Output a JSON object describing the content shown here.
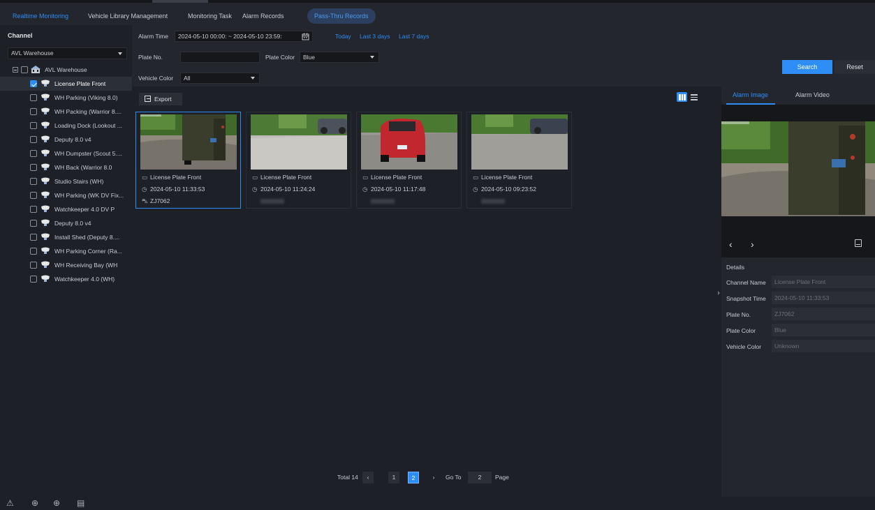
{
  "nav": {
    "tabs": [
      {
        "label": "Realtime Monitoring"
      },
      {
        "label": "Vehicle Library Management"
      },
      {
        "label": "Monitoring Task"
      },
      {
        "label": "Alarm Records"
      },
      {
        "label": "Pass-Thru Records"
      }
    ],
    "active_tab": "Pass-Thru Records"
  },
  "sidebar": {
    "title": "Channel",
    "group_select": "AVL Warehouse",
    "root": "AVL Warehouse",
    "channels": [
      {
        "label": "License Plate Front",
        "checked": true
      },
      {
        "label": "WH Parking (Viking 8.0)",
        "checked": false
      },
      {
        "label": "WH Packing (Warrior 8....",
        "checked": false
      },
      {
        "label": "Loading Dock (Lookout ...",
        "checked": false
      },
      {
        "label": "Deputy 8.0 v4",
        "checked": false
      },
      {
        "label": "WH Dumpster (Scout 5....",
        "checked": false
      },
      {
        "label": "WH Back (Warrior 8.0",
        "checked": false
      },
      {
        "label": "Studio Stairs (WH)",
        "checked": false
      },
      {
        "label": "WH Parking (WK DV Fix...",
        "checked": false
      },
      {
        "label": "Watchkeeper 4.0 DV P",
        "checked": false
      },
      {
        "label": "Deputy 8.0 v4",
        "checked": false
      },
      {
        "label": "Install Shed (Deputy 8....",
        "checked": false
      },
      {
        "label": "WH Parking Corner (Ra...",
        "checked": false
      },
      {
        "label": "WH Receiving Bay (WH",
        "checked": false
      },
      {
        "label": "Watchkeeper 4.0 (WH)",
        "checked": false
      }
    ]
  },
  "filters": {
    "alarm_time_label": "Alarm Time",
    "alarm_time_value": "2024-05-10 00:00: ~ 2024-05-10 23:59:",
    "quick_today": "Today",
    "quick_3days": "Last 3 days",
    "quick_7days": "Last 7 days",
    "plate_no_label": "Plate No.",
    "plate_no_value": "",
    "plate_color_label": "Plate Color",
    "plate_color_value": "Blue",
    "vehicle_color_label": "Vehicle Color",
    "vehicle_color_value": "All",
    "search_label": "Search",
    "reset_label": "Reset"
  },
  "toolbar": {
    "export_label": "Export"
  },
  "records": [
    {
      "channel": "License Plate Front",
      "time": "2024-05-10 11:33:53",
      "plate": "ZJ7062",
      "selected": true
    },
    {
      "channel": "License Plate Front",
      "time": "2024-05-10 11:24:24",
      "plate": "",
      "selected": false
    },
    {
      "channel": "License Plate Front",
      "time": "2024-05-10 11:17:48",
      "plate": "",
      "selected": false
    },
    {
      "channel": "License Plate Front",
      "time": "2024-05-10 09:23:52",
      "plate": "",
      "selected": false
    }
  ],
  "pagination": {
    "total_label": "Total 14",
    "pages": [
      "1",
      "2"
    ],
    "current": "2",
    "goto_label": "Go To",
    "goto_value": "2",
    "page_label": "Page"
  },
  "detail_panel": {
    "tab_image": "Alarm Image",
    "tab_video": "Alarm Video",
    "details_title": "Details",
    "fields": [
      {
        "label": "Channel Name",
        "value": "License Plate Front"
      },
      {
        "label": "Snapshot Time",
        "value": "2024-05-10 11:33:53"
      },
      {
        "label": "Plate No.",
        "value": "ZJ7062"
      },
      {
        "label": "Plate Color",
        "value": "Blue"
      },
      {
        "label": "Vehicle Color",
        "value": "Unknown"
      }
    ]
  },
  "icons": {
    "alarm": "warning-icon",
    "upload": "upload-icon",
    "download": "download-icon",
    "clipboard": "clipboard-icon"
  },
  "colors": {
    "accent": "#2e8ef5",
    "background": "#1d2026",
    "panel": "#23262d"
  }
}
